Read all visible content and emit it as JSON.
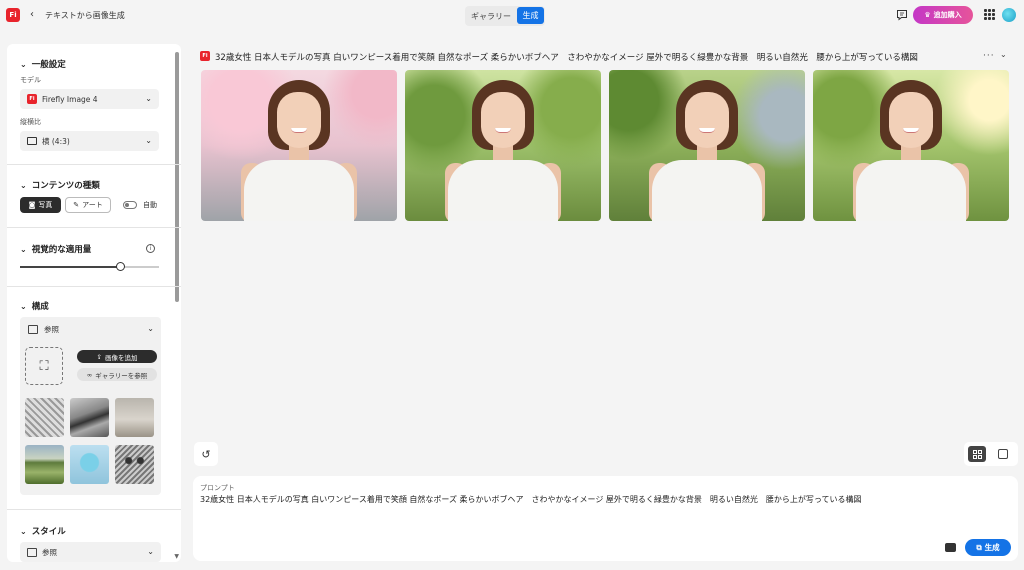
{
  "header": {
    "logo_text": "Fi",
    "back_glyph": "‹",
    "title": "テキストから画像生成",
    "tabs": [
      {
        "label": "ギャラリー",
        "selected": false
      },
      {
        "label": "生成",
        "selected": true
      }
    ],
    "buy_label": "追加購入",
    "icons": [
      "feedback-icon",
      "apps-grid-icon",
      "avatar"
    ]
  },
  "sidebar": {
    "general": {
      "title": "一般設定",
      "model_label": "モデル",
      "model_value": "Firefly Image 4",
      "ratio_label": "縦横比",
      "ratio_value": "横 (4:3)"
    },
    "content_type": {
      "title": "コンテンツの種類",
      "photo_label": "写真",
      "art_label": "アート",
      "auto_label": "自動",
      "selected": "写真"
    },
    "visual_intensity": {
      "title": "視覚的な適用量",
      "info_glyph": "i",
      "value": 0.72
    },
    "composition": {
      "title": "構成",
      "reference_label": "参照",
      "add_image_label": "画像を追加",
      "browse_gallery_label": "ギャラリーを参照",
      "thumbnails": [
        "sketch-bird",
        "mountain-landscape",
        "living-room",
        "green-road",
        "blue-sphere",
        "owl-sketch"
      ]
    },
    "style": {
      "title": "スタイル",
      "reference_label": "参照"
    }
  },
  "main": {
    "badge_text": "Fi",
    "prompt_heading": "32歳女性 日本人モデルの写真 白いワンピース着用で笑顔 自然なポーズ 柔らかいボブヘア　さわやかなイメージ 屋外で明るく緑豊かな背景　明るい自然光　腰から上が写っている構図",
    "more_glyph": "···",
    "collapse_glyph": "⌄",
    "results": [
      {
        "name": "result-image-1",
        "scene": "cherry-blossom-background"
      },
      {
        "name": "result-image-2",
        "scene": "green-park-background"
      },
      {
        "name": "result-image-3",
        "scene": "green-street-background"
      },
      {
        "name": "result-image-4",
        "scene": "sunlit-trees-background"
      }
    ]
  },
  "prompt": {
    "label": "プロンプト",
    "text": "32歳女性 日本人モデルの写真 白いワンピース着用で笑顔 自然なポーズ 柔らかいボブヘア　さわやかなイメージ 屋外で明るく緑豊かな背景　明るい自然光　腰から上が写っている構図",
    "generate_label": "生成"
  },
  "colors": {
    "accent": "#1473e6",
    "brand": "#e8242c",
    "buy_gradient": [
      "#c437c6",
      "#e6549a"
    ]
  }
}
